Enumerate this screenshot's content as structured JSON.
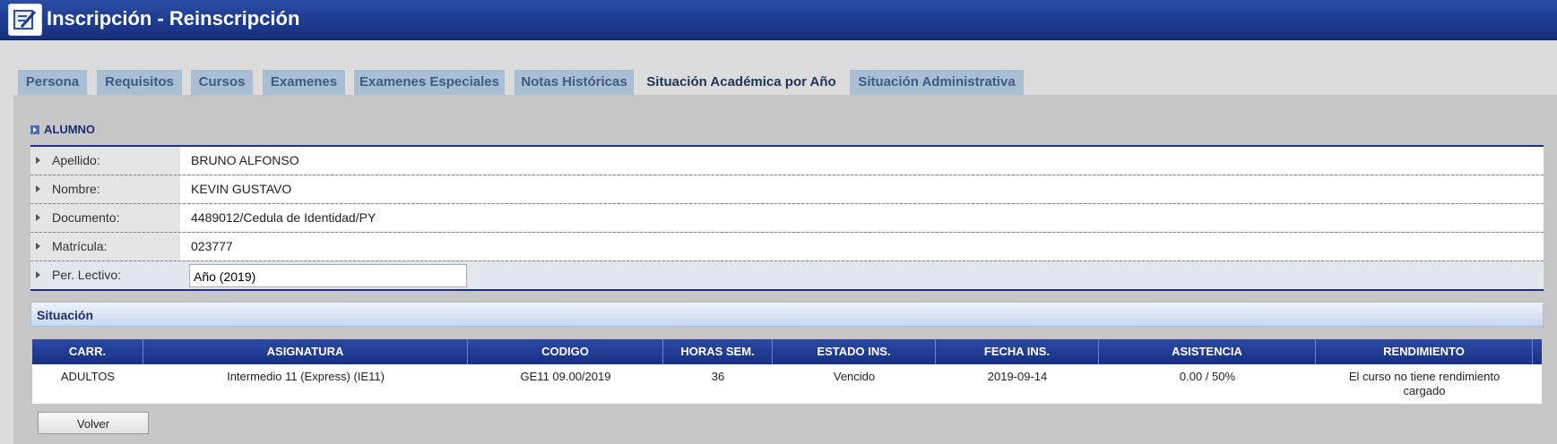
{
  "window": {
    "title": "Inscripción - Reinscripción",
    "icon": "edit-form-icon"
  },
  "tabs": [
    {
      "label": "Persona",
      "active": false
    },
    {
      "label": "Requisitos",
      "active": false
    },
    {
      "label": "Cursos",
      "active": false
    },
    {
      "label": "Examenes",
      "active": false
    },
    {
      "label": "Examenes Especiales",
      "active": false
    },
    {
      "label": "Notas Históricas",
      "active": false
    },
    {
      "label": "Situación Académica por Año",
      "active": true
    },
    {
      "label": "Situación Administrativa",
      "active": false
    }
  ],
  "alumno": {
    "heading": "ALUMNO",
    "fields": [
      {
        "label": "Apellido:",
        "value": "BRUNO ALFONSO"
      },
      {
        "label": "Nombre:",
        "value": "KEVIN GUSTAVO"
      },
      {
        "label": "Documento:",
        "value": "4489012/Cedula de Identidad/PY"
      },
      {
        "label": "Matrícula:",
        "value": "023777"
      },
      {
        "label": "Per. Lectivo:",
        "value": "Año (2019)"
      }
    ]
  },
  "situacion": {
    "heading": "Situación",
    "columns": [
      "CARR.",
      "ASIGNATURA",
      "CODIGO",
      "HORAS SEM.",
      "ESTADO INS.",
      "FECHA INS.",
      "ASISTENCIA",
      "RENDIMIENTO"
    ],
    "rows": [
      [
        "ADULTOS",
        "Intermedio 11 (Express) (IE11)",
        "GE11 09.00/2019",
        "36",
        "Vencido",
        "2019-09-14",
        "0.00 / 50%",
        "El curso no tiene rendimiento cargado"
      ]
    ]
  },
  "buttons": {
    "back": "Volver"
  },
  "colors": {
    "titlebar": "#1c3a8e",
    "header": "#1c2f8c",
    "tab": "#a9bdd3"
  }
}
